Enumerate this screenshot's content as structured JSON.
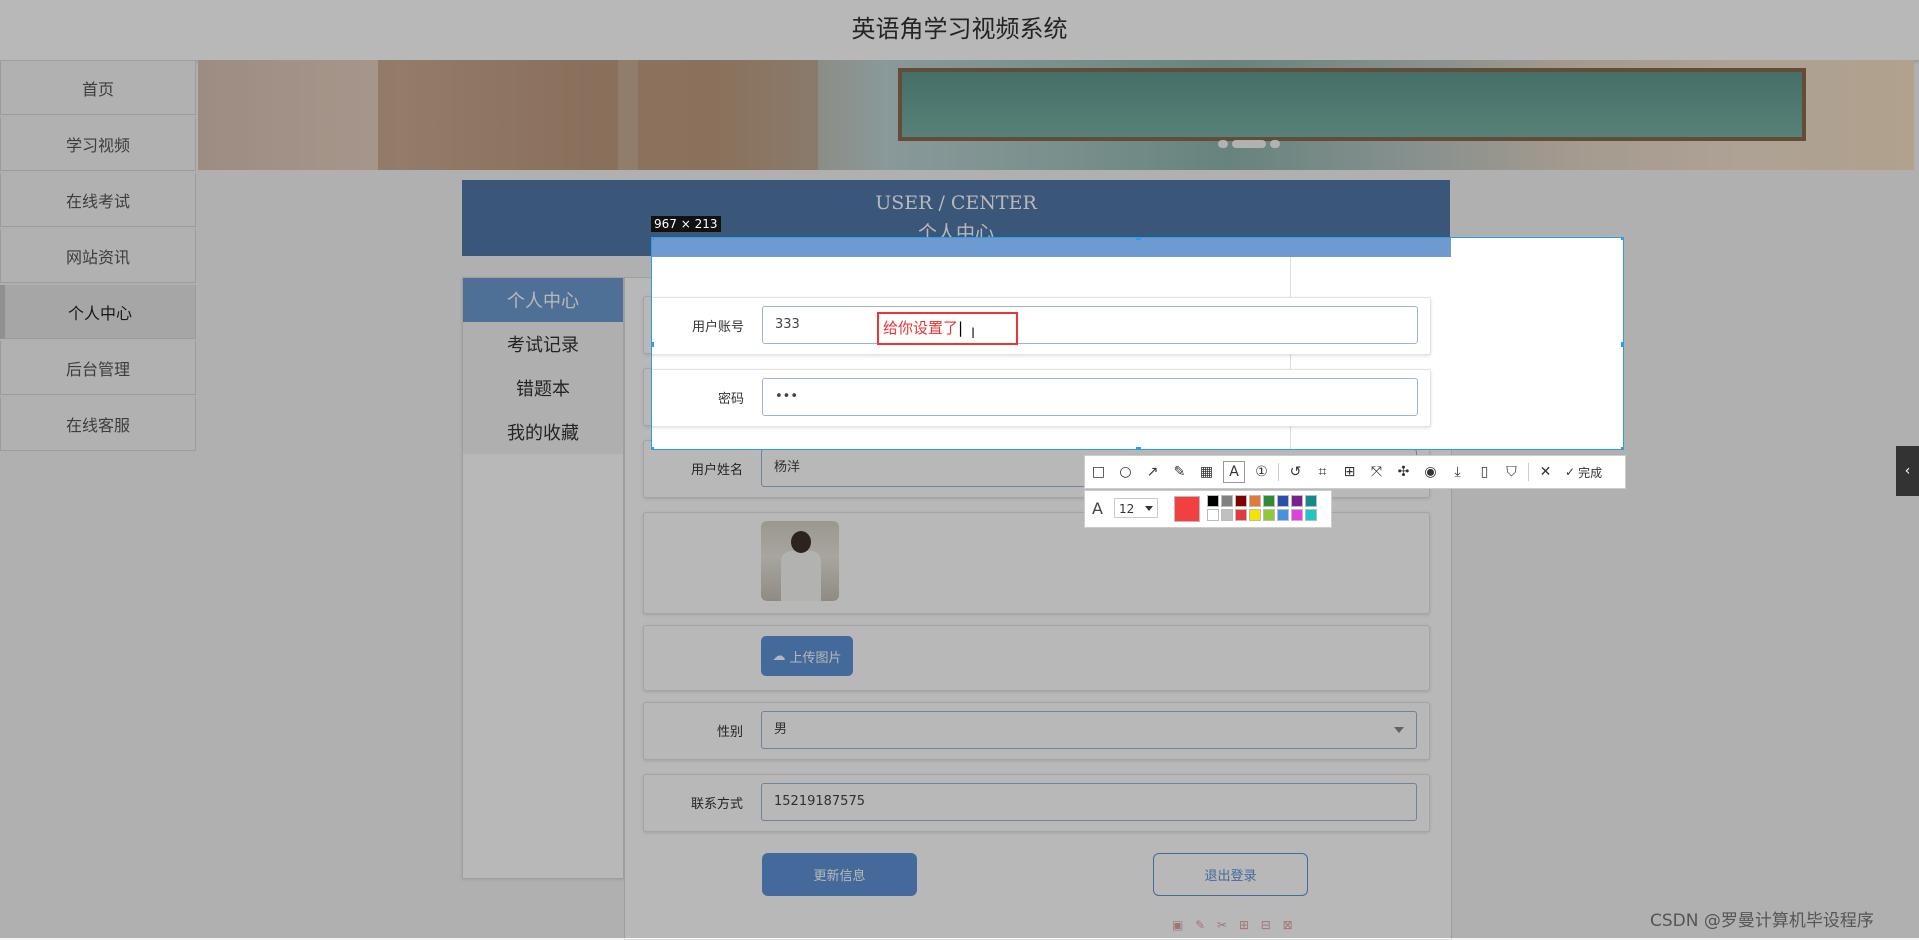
{
  "header": {
    "title": "英语角学习视频系统"
  },
  "sidebar": {
    "items": [
      {
        "label": "首页"
      },
      {
        "label": "学习视频"
      },
      {
        "label": "在线考试"
      },
      {
        "label": "网站资讯"
      },
      {
        "label": "个人中心"
      },
      {
        "label": "后台管理"
      },
      {
        "label": "在线客服"
      }
    ],
    "active_index": 4
  },
  "user_center": {
    "title_en": "USER / CENTER",
    "title_zh": "个人中心"
  },
  "center_menu": {
    "items": [
      {
        "label": "个人中心"
      },
      {
        "label": "考试记录"
      },
      {
        "label": "错题本"
      },
      {
        "label": "我的收藏"
      }
    ],
    "active_index": 0
  },
  "form": {
    "account": {
      "label": "用户账号",
      "value": "333"
    },
    "password": {
      "label": "密码",
      "value": "•••"
    },
    "name": {
      "label": "用户姓名",
      "value": "杨洋"
    },
    "upload_label": "上传图片",
    "gender": {
      "label": "性别",
      "value": "男"
    },
    "phone": {
      "label": "联系方式",
      "value": "15219187575"
    },
    "update_button": "更新信息",
    "logout_button": "退出登录"
  },
  "screenshot_tool": {
    "size_label": "967 × 213",
    "annotation_text": "给你设置了",
    "font_size": "12",
    "current_color": "#f23f3f",
    "palette": [
      "#000000",
      "#808080",
      "#800000",
      "#e07b39",
      "#2e8b3a",
      "#2b4fae",
      "#7a1f8f",
      "#138a8a",
      "#ffffff",
      "#c0c0c0",
      "#e33b3b",
      "#f5e300",
      "#8fc93a",
      "#4a8fe0",
      "#e040e0",
      "#22c5c5"
    ],
    "done_label": "完成",
    "tools": [
      "rectangle-icon",
      "ellipse-icon",
      "arrow-icon",
      "pen-icon",
      "mosaic-icon",
      "text-icon",
      "serial-number-icon",
      "undo-icon",
      "ocr-icon",
      "translate-icon",
      "scroll-capture-icon",
      "pin-icon",
      "record-icon",
      "save-icon",
      "long-screenshot-icon",
      "bookmark-icon"
    ]
  },
  "watermark": "CSDN @罗曼计算机毕设程序"
}
